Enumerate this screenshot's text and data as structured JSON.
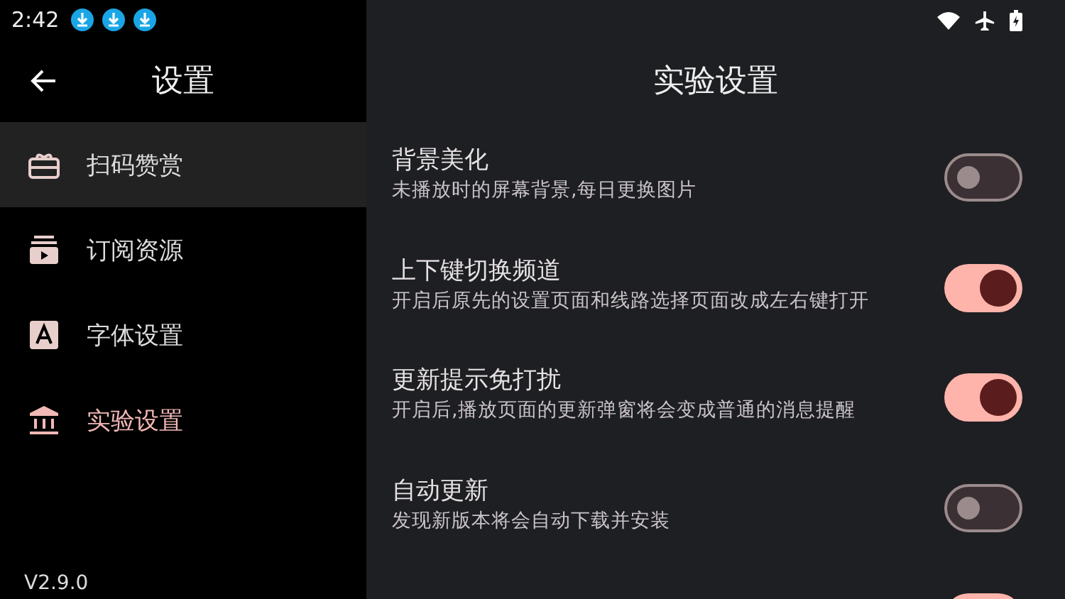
{
  "status_bar": {
    "time": "2:42",
    "notifications": [
      {
        "kind": "download"
      },
      {
        "kind": "download"
      },
      {
        "kind": "download"
      }
    ]
  },
  "sidebar": {
    "title": "设置",
    "items": [
      {
        "label": "扫码赞赏",
        "kind": "gift",
        "selected": false,
        "focused": true
      },
      {
        "label": "订阅资源",
        "kind": "subscribe",
        "selected": false,
        "focused": false
      },
      {
        "label": "字体设置",
        "kind": "font",
        "selected": false,
        "focused": false
      },
      {
        "label": "实验设置",
        "kind": "lab",
        "selected": true,
        "focused": false
      }
    ],
    "version": "V2.9.0"
  },
  "content": {
    "title": "实验设置",
    "settings": [
      {
        "title": "背景美化",
        "subtitle": "未播放时的屏幕背景,每日更换图片",
        "on": false
      },
      {
        "title": "上下键切换频道",
        "subtitle": "开启后原先的设置页面和线路选择页面改成左右键打开",
        "on": true
      },
      {
        "title": "更新提示免打扰",
        "subtitle": "开启后,播放页面的更新弹窗将会变成普通的消息提醒",
        "on": true
      },
      {
        "title": "自动更新",
        "subtitle": "发现新版本将会自动下载并安装",
        "on": false
      },
      {
        "on": true
      }
    ]
  }
}
